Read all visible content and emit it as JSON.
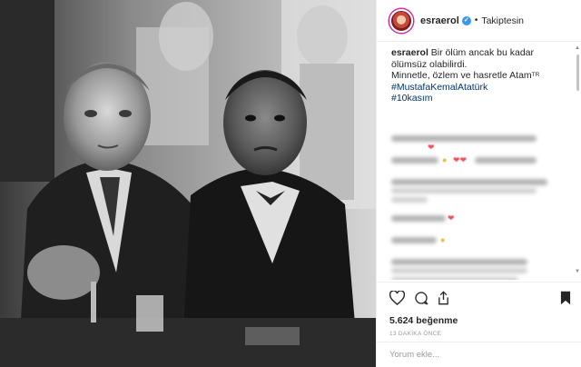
{
  "post": {
    "username": "esraerol",
    "verified_mark": "✓",
    "separator": "•",
    "follow_state": "Takiptesin",
    "caption": {
      "username": "esraerol",
      "line1": "Bir ölüm ancak bu kadar ölümsüz olabilirdi.",
      "line2": "Minnetle, özlem ve hasretle Atam",
      "flag": "TR",
      "hashtag1": "#MustafaKemalAtatürk",
      "hashtag2": "#10kasım"
    },
    "likes": "5.624 beğenme",
    "time_ago": "13 DAKİKA ÖNCE",
    "comment_placeholder": "Yorum ekle..."
  },
  "colors": {
    "verified": "#3897f0",
    "hashtag": "#003569",
    "like_heart": "#ed4956"
  },
  "icons": [
    "heart-icon",
    "comment-icon",
    "share-icon",
    "bookmark-icon"
  ]
}
